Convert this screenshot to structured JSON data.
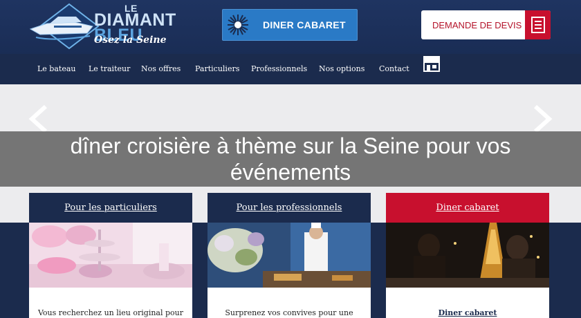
{
  "header": {
    "logo_line1": "LE",
    "logo_line2": "DIAMANT",
    "logo_line3": "BLEU",
    "logo_tagline": "Osez la Seine",
    "cabaret_button": "DINER CABARET",
    "devis_button": "DEMANDE DE DEVIS"
  },
  "nav": {
    "items": [
      "Le bateau",
      "Le traiteur",
      "Nos offres",
      "Particuliers",
      "Professionnels",
      "Nos options",
      "Contact"
    ]
  },
  "hero": {
    "title": "dîner croisière à thème sur la Seine pour vos événements"
  },
  "cards": [
    {
      "title": "Pour les particuliers",
      "text": "Vous recherchez un lieu original pour",
      "head_color": "#1b2b4d"
    },
    {
      "title": "Pour les professionnels",
      "text": "Surprenez vos convives pour une",
      "head_color": "#1b2b4d"
    },
    {
      "title": "Diner cabaret",
      "text": "Diner cabaret",
      "head_color": "#c8102e"
    }
  ],
  "icons": {
    "slider_prev": "chevron-left-icon",
    "slider_next": "chevron-right-icon",
    "devis": "document-list-icon",
    "shop": "storefront-icon",
    "cabaret": "starburst-icon"
  }
}
